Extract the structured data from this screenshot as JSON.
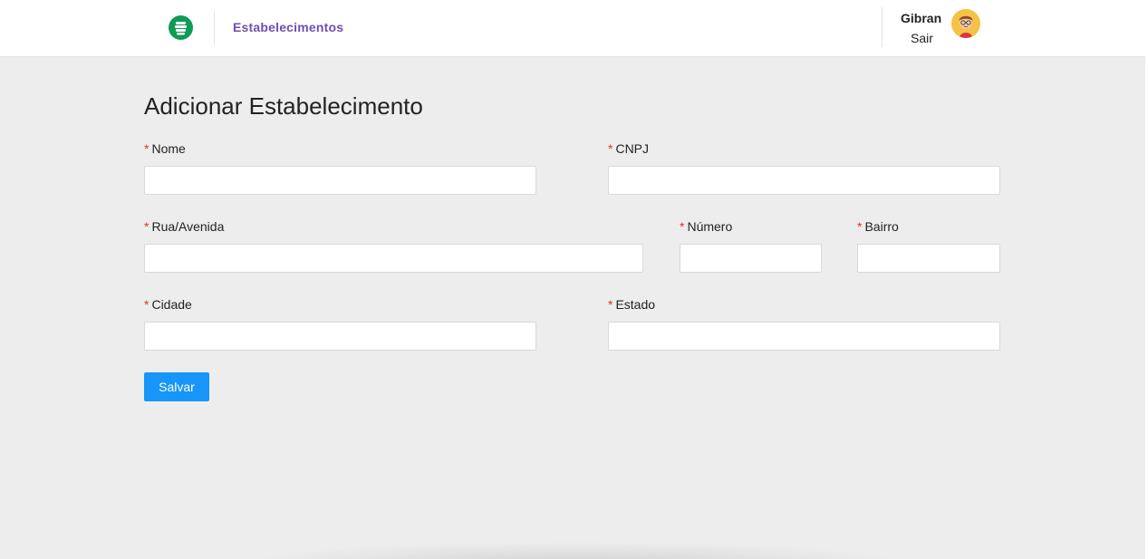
{
  "header": {
    "logo_icon": "coins-logo-icon",
    "nav_link": "Estabelecimentos",
    "user_name": "Gibran",
    "logout_label": "Sair",
    "avatar_icon": "user-avatar-icon"
  },
  "form": {
    "title": "Adicionar Estabelecimento",
    "required_mark": "*",
    "fields": {
      "nome": {
        "label": "Nome",
        "value": ""
      },
      "cnpj": {
        "label": "CNPJ",
        "value": ""
      },
      "rua": {
        "label": "Rua/Avenida",
        "value": ""
      },
      "numero": {
        "label": "Número",
        "value": ""
      },
      "bairro": {
        "label": "Bairro",
        "value": ""
      },
      "cidade": {
        "label": "Cidade",
        "value": ""
      },
      "estado": {
        "label": "Estado",
        "value": ""
      }
    },
    "save_label": "Salvar"
  },
  "colors": {
    "accent": "#1795f8",
    "nav_link": "#6f4fb0",
    "required": "#e0342a",
    "logo": "#0f9b55",
    "background": "#ededed"
  }
}
